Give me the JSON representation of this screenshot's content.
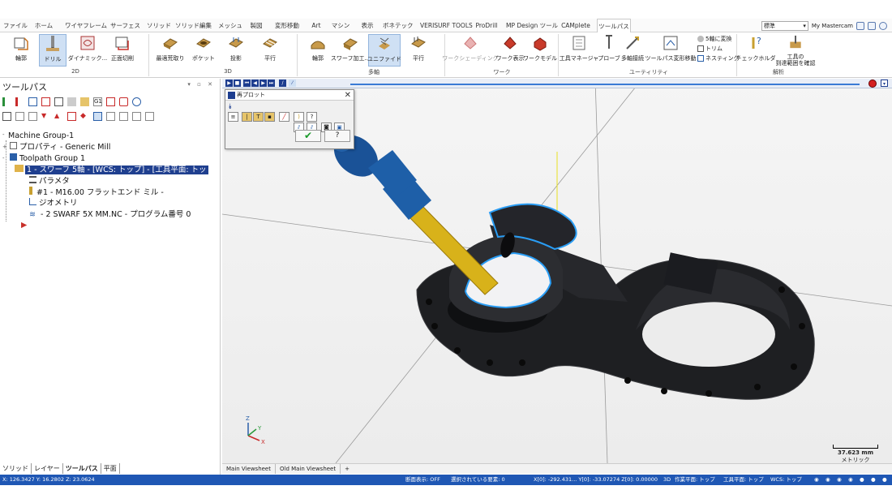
{
  "ribbon": {
    "tabs": [
      "ファイル",
      "ホーム",
      "ワイヤフレーム",
      "サーフェス",
      "ソリッド",
      "ソリッド編集",
      "メッシュ",
      "製図",
      "変形移動",
      "Art",
      "マシン",
      "表示",
      "ボネテック",
      "VERISURF TOOLS",
      "ProDrill",
      "MP Design ツール",
      "CAMplete",
      "ツールパス"
    ],
    "active_tab": "ツールパス",
    "workspace_value": "標準",
    "my_mastercam": "My Mastercam",
    "groups": {
      "g2d": "2D",
      "g3d": "3D",
      "multiaxis": "多軸",
      "work": "ワーク",
      "utility": "ユーティリティ",
      "analysis": "解析"
    },
    "buttons_2d": [
      "輪郭",
      "ドリル",
      "ダイナミック...",
      "正面切削"
    ],
    "buttons_3d": [
      "最適荒取り",
      "ポケット",
      "投影",
      "平行"
    ],
    "buttons_multi": [
      "輪郭",
      "スワーフ加工...",
      "ユニファイド",
      "平行"
    ],
    "buttons_work": [
      "ワークシェーディング",
      "ワーク表示",
      "ワークモデル"
    ],
    "buttons_util": [
      "工具マネージャ",
      "プローブ",
      "多軸接続",
      "ツールパス変形移動"
    ],
    "util_small": [
      "5軸に変換",
      "トリム",
      "ネスティング"
    ],
    "buttons_analysis": [
      "チェックホルダ",
      "工具の\n到達範囲を確認"
    ]
  },
  "left_panel": {
    "title": "ツールパス",
    "tree": {
      "machine_group": "Machine Group-1",
      "properties": "プロパティ - Generic Mill",
      "toolpath_group": "Toolpath Group 1",
      "operation": "1 - スワーフ 5軸 - [WCS: トップ] - [工具平面: トッ",
      "params": "パラメタ",
      "tool": "#1 - M16.00 フラットエンド ミル -",
      "geometry": "ジオメトリ",
      "nc": "- 2 SWARF 5X MM.NC - プログラム番号 0"
    },
    "bottom_tabs": [
      "ソリッド",
      "レイヤー",
      "ツールパス",
      "平面"
    ]
  },
  "dialog": {
    "title": "再プロット"
  },
  "viewport": {
    "scale_value": "37.623 mm",
    "scale_unit": "メトリック",
    "tabs": [
      "Main Viewsheet",
      "Old Main Viewsheet",
      "+"
    ],
    "axis_x": "X",
    "axis_y": "Y",
    "axis_z": "Z"
  },
  "status": {
    "coords": "X: 126.3427  Y: 16.2802  Z: 23.0624",
    "section": "断面表示: OFF",
    "selected": "選択されている要素: 0",
    "xyz": "X[0]: -292.431...  Y[0]: -33.07274  Z[0]: 0.00000",
    "mode": "3D",
    "cplane": "作業平面: トップ",
    "tplane": "工具平面: トップ",
    "wcs": "WCS: トップ"
  },
  "colors": {
    "status_bg": "#1f57b4",
    "selection": "#1f3f8f",
    "part": "#1e1f22",
    "tool_holder": "#1e5fa8",
    "tool": "#d8b21a",
    "highlight": "#2a9df4"
  }
}
